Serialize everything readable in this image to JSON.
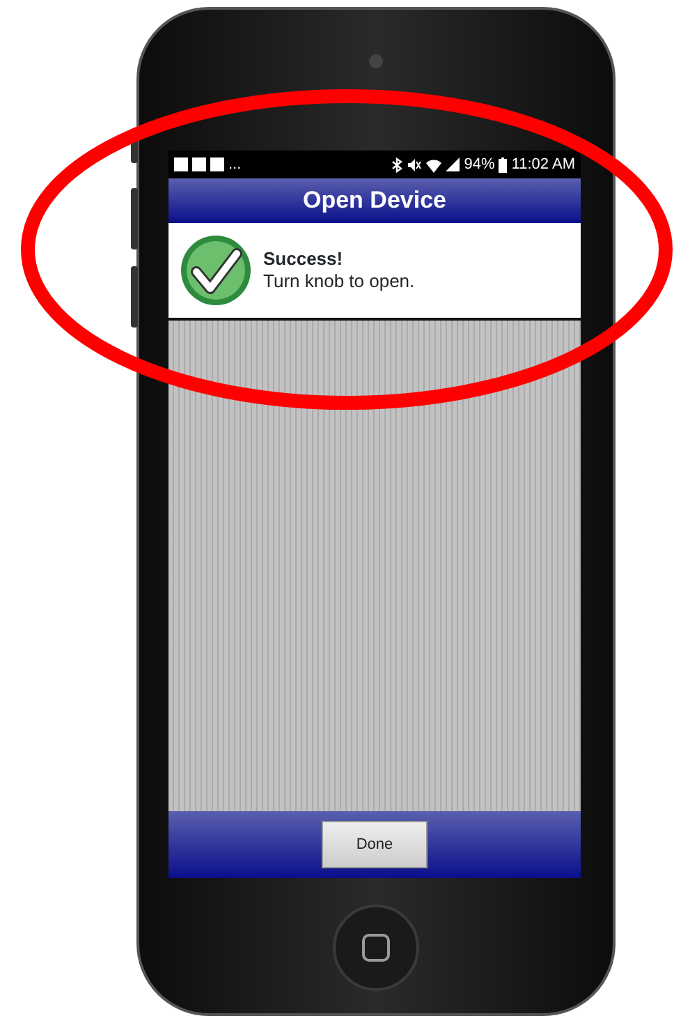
{
  "status_bar": {
    "overflow": "...",
    "battery": "94%",
    "time": "11:02 AM"
  },
  "title": "Open Device",
  "message": {
    "heading": "Success!",
    "text": "Turn knob to open."
  },
  "buttons": [
    {
      "label": "Done"
    }
  ]
}
